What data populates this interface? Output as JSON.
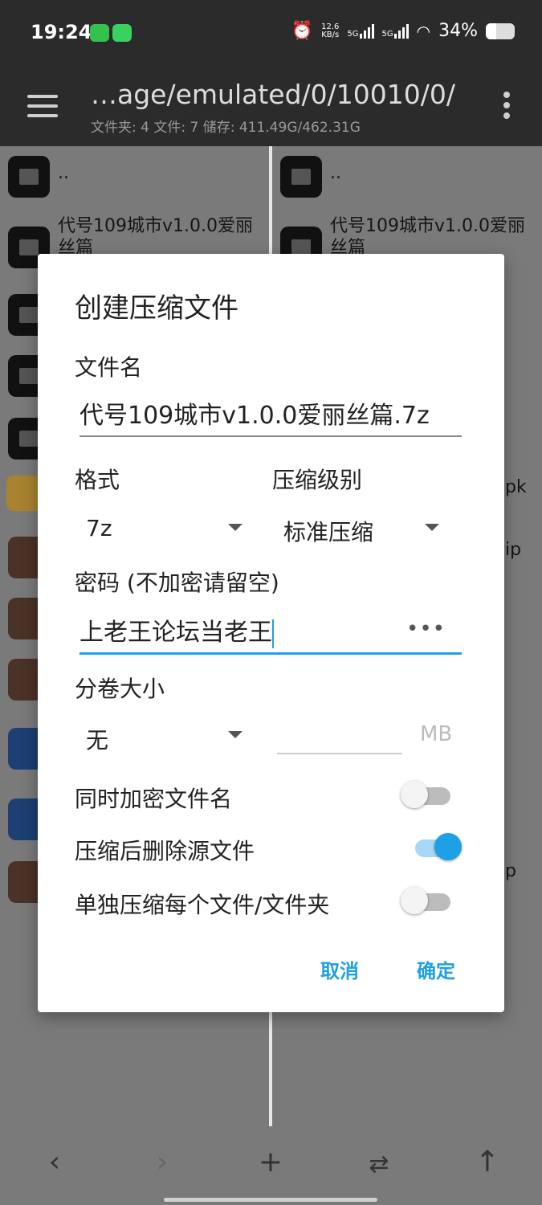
{
  "status_bar": {
    "time": "19:24",
    "net_speed_value": "12.6",
    "net_speed_unit": "KB/s",
    "sim1": "5G",
    "sim2": "5G",
    "battery": "34%"
  },
  "toolbar": {
    "path": "…age/emulated/0/10010/0/",
    "info": "文件夹: 4  文件: 7  储存: 411.49G/462.31G"
  },
  "left_pane": {
    "items": [
      {
        "type": "folder",
        "label": ".."
      },
      {
        "type": "folder",
        "label": "代号109城市v1.0.0爱丽丝篇"
      }
    ]
  },
  "right_pane": {
    "items": [
      {
        "type": "folder",
        "label": ".."
      },
      {
        "type": "folder",
        "label": "代号109城市v1.0.0爱丽丝篇"
      }
    ],
    "partial_suffixes": [
      "pk",
      "ip",
      "p"
    ]
  },
  "dialog": {
    "title": "创建压缩文件",
    "filename_label": "文件名",
    "filename_value": "代号109城市v1.0.0爱丽丝篇.7z",
    "format_label": "格式",
    "format_value": "7z",
    "level_label": "压缩级别",
    "level_value": "标准压缩",
    "password_label": "密码 (不加密请留空)",
    "password_value": "上老王论坛当老王",
    "password_toggle": "•••",
    "split_label": "分卷大小",
    "split_value": "无",
    "split_unit": "MB",
    "toggles": [
      {
        "label": "同时加密文件名",
        "on": false
      },
      {
        "label": "压缩后删除源文件",
        "on": true
      },
      {
        "label": "单独压缩每个文件/文件夹",
        "on": false
      }
    ],
    "cancel": "取消",
    "confirm": "确定"
  },
  "bottom_bar": {
    "icons": [
      "back-icon",
      "forward-icon",
      "add-icon",
      "swap-icon",
      "up-icon"
    ]
  }
}
